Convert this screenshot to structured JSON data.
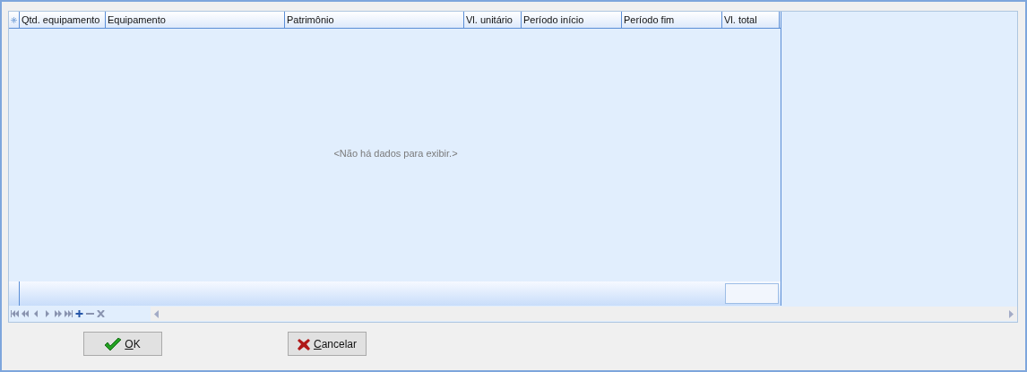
{
  "table": {
    "columns": [
      {
        "label": "Qtd. equipamento"
      },
      {
        "label": "Equipamento"
      },
      {
        "label": "Patrimônio"
      },
      {
        "label": "Vl. unitário"
      },
      {
        "label": "Período início"
      },
      {
        "label": "Período fim"
      },
      {
        "label": "Vl. total"
      }
    ],
    "empty_message": "<Não há dados para exibir.>"
  },
  "buttons": [
    {
      "kind": "ok",
      "label": "OK"
    },
    {
      "kind": "cancel",
      "label": "Cancelar"
    }
  ]
}
